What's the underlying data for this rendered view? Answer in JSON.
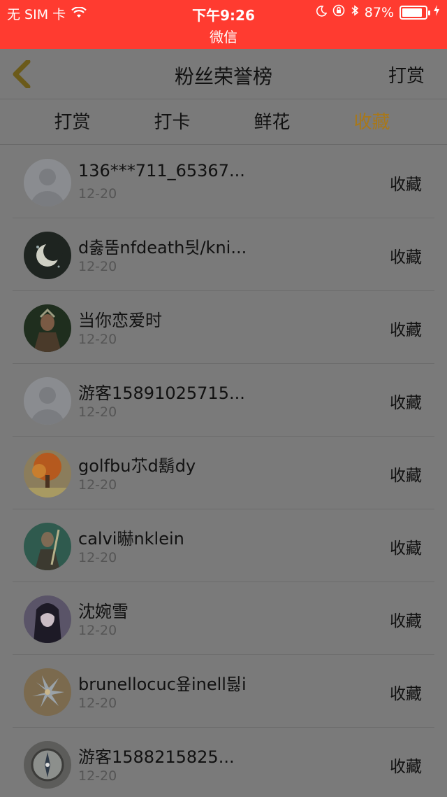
{
  "status_bar": {
    "carrier": "无 SIM 卡",
    "time": "下午9:26",
    "battery": "87%",
    "app_back_label": "微信",
    "battery_level": 0.87
  },
  "nav": {
    "title": "粉丝荣誉榜",
    "right": "打赏"
  },
  "tabs": [
    {
      "label": "打赏",
      "active": false
    },
    {
      "label": "打卡",
      "active": false
    },
    {
      "label": "鲜花",
      "active": false
    },
    {
      "label": "收藏",
      "active": true
    }
  ],
  "list": [
    {
      "name": "136***711_65367...",
      "date": "12-20",
      "action": "收藏",
      "avatar": "default-avatar-icon"
    },
    {
      "name": "d춣뚬nfdeath딋/kni...",
      "date": "12-20",
      "action": "收藏",
      "avatar": "moon-avatar"
    },
    {
      "name": "当你恋爱时",
      "date": "12-20",
      "action": "收藏",
      "avatar": "warrior-avatar"
    },
    {
      "name": "游客15891025715...",
      "date": "12-20",
      "action": "收藏",
      "avatar": "default-avatar-icon"
    },
    {
      "name": "golfbu䒕d鬍dy",
      "date": "12-20",
      "action": "收藏",
      "avatar": "autumn-tree-avatar"
    },
    {
      "name": "calvi㬨nklein",
      "date": "12-20",
      "action": "收藏",
      "avatar": "knight-avatar"
    },
    {
      "name": "沈婉雪",
      "date": "12-20",
      "action": "收藏",
      "avatar": "anime-girl-avatar"
    },
    {
      "name": "brunellocuc욮inell딇i",
      "date": "12-20",
      "action": "收藏",
      "avatar": "flower-avatar"
    },
    {
      "name": "游客1588215825...",
      "date": "12-20",
      "action": "收藏",
      "avatar": "compass-avatar"
    }
  ],
  "colors": {
    "status_bar": "#ff3b30",
    "active_tab": "#a8781a",
    "overlay_bg": "#7a7a7a"
  }
}
